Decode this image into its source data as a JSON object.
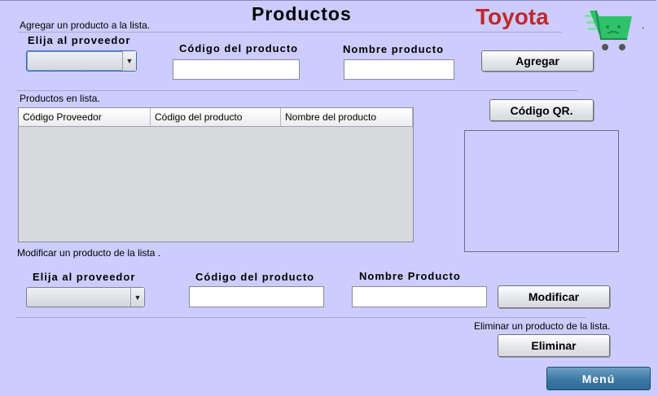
{
  "header": {
    "title": "Productos",
    "brand": "Toyota",
    "brand_color": "#c0282b",
    "cart_icon": "shopping-cart-icon",
    "corner_mark": "."
  },
  "add_section": {
    "caption": "Agregar un producto a la lista.",
    "provider_label": "Elija al proveedor",
    "provider_value": "",
    "code_label": "Código del producto",
    "code_value": "",
    "name_label": "Nombre producto",
    "name_value": "",
    "add_button": "Agregar"
  },
  "list_section": {
    "caption": "Productos en lista.",
    "columns": [
      "Código Proveedor",
      "Código del producto",
      "Nombre del producto"
    ],
    "rows": []
  },
  "qr": {
    "button": "Código QR."
  },
  "modify_section": {
    "caption": "Modificar un producto de la lista .",
    "provider_label": "Elija al proveedor",
    "provider_value": "",
    "code_label": "Código del producto",
    "code_value": "",
    "name_label": "Nombre Producto",
    "name_value": "",
    "modify_button": "Modificar"
  },
  "delete_section": {
    "caption": "Eliminar un producto de la lista.",
    "delete_button": "Eliminar"
  },
  "menu_button": "Menú"
}
